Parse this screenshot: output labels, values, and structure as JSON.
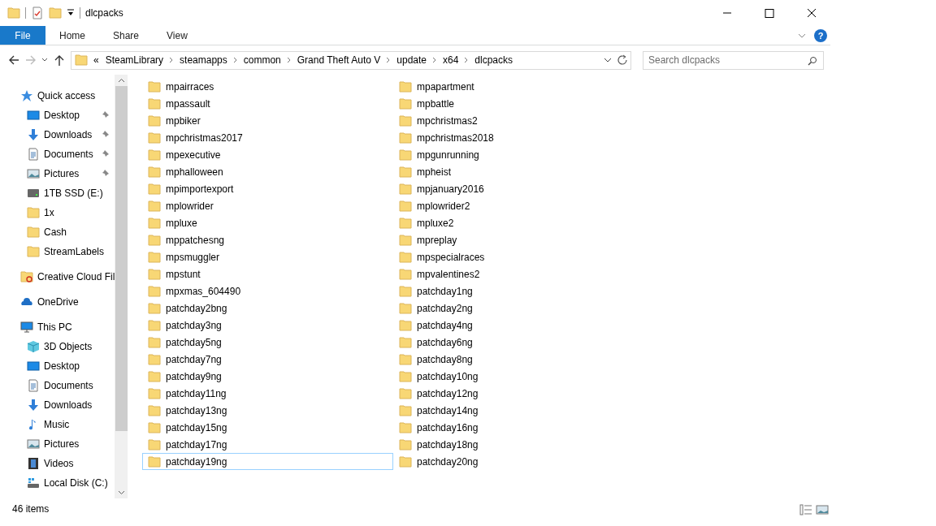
{
  "window": {
    "title": "dlcpacks"
  },
  "ribbon": {
    "tabs": [
      {
        "label": "File",
        "selected": true
      },
      {
        "label": "Home",
        "selected": false
      },
      {
        "label": "Share",
        "selected": false
      },
      {
        "label": "View",
        "selected": false
      }
    ],
    "help": "?"
  },
  "address_bar": {
    "overflow": "«",
    "segments": [
      "SteamLibrary",
      "steamapps",
      "common",
      "Grand Theft Auto V",
      "update",
      "x64",
      "dlcpacks"
    ]
  },
  "search": {
    "placeholder": "Search dlcpacks"
  },
  "sidebar": {
    "items": [
      {
        "label": "Quick access",
        "kind": "star",
        "children": [
          {
            "label": "Desktop",
            "kind": "desktop",
            "pinned": true
          },
          {
            "label": "Downloads",
            "kind": "downloads",
            "pinned": true
          },
          {
            "label": "Documents",
            "kind": "documents",
            "pinned": true
          },
          {
            "label": "Pictures",
            "kind": "pictures",
            "pinned": true
          },
          {
            "label": "1TB SSD (E:)",
            "kind": "drive",
            "pinned": false
          },
          {
            "label": "1x",
            "kind": "folder",
            "pinned": false
          },
          {
            "label": "Cash",
            "kind": "folder",
            "pinned": false
          },
          {
            "label": "StreamLabels",
            "kind": "folder",
            "pinned": false
          }
        ]
      },
      {
        "label": "Creative Cloud Fil",
        "kind": "cloudfolder"
      },
      {
        "label": "OneDrive",
        "kind": "onedrive"
      },
      {
        "label": "This PC",
        "kind": "pc",
        "children": [
          {
            "label": "3D Objects",
            "kind": "objects",
            "pinned": false
          },
          {
            "label": "Desktop",
            "kind": "desktop",
            "pinned": false
          },
          {
            "label": "Documents",
            "kind": "documents",
            "pinned": false
          },
          {
            "label": "Downloads",
            "kind": "downloads",
            "pinned": false
          },
          {
            "label": "Music",
            "kind": "music",
            "pinned": false
          },
          {
            "label": "Pictures",
            "kind": "pictures",
            "pinned": false
          },
          {
            "label": "Videos",
            "kind": "videos",
            "pinned": false
          },
          {
            "label": "Local Disk (C:)",
            "kind": "disk",
            "pinned": false
          }
        ]
      }
    ]
  },
  "files": [
    {
      "name": "mpairraces",
      "focused": false
    },
    {
      "name": "mpapartment",
      "focused": false
    },
    {
      "name": "mpassault",
      "focused": false
    },
    {
      "name": "mpbattle",
      "focused": false
    },
    {
      "name": "mpbiker",
      "focused": false
    },
    {
      "name": "mpchristmas2",
      "focused": false
    },
    {
      "name": "mpchristmas2017",
      "focused": false
    },
    {
      "name": "mpchristmas2018",
      "focused": false
    },
    {
      "name": "mpexecutive",
      "focused": false
    },
    {
      "name": "mpgunrunning",
      "focused": false
    },
    {
      "name": "mphalloween",
      "focused": false
    },
    {
      "name": "mpheist",
      "focused": false
    },
    {
      "name": "mpimportexport",
      "focused": false
    },
    {
      "name": "mpjanuary2016",
      "focused": false
    },
    {
      "name": "mplowrider",
      "focused": false
    },
    {
      "name": "mplowrider2",
      "focused": false
    },
    {
      "name": "mpluxe",
      "focused": false
    },
    {
      "name": "mpluxe2",
      "focused": false
    },
    {
      "name": "mppatchesng",
      "focused": false
    },
    {
      "name": "mpreplay",
      "focused": false
    },
    {
      "name": "mpsmuggler",
      "focused": false
    },
    {
      "name": "mpspecialraces",
      "focused": false
    },
    {
      "name": "mpstunt",
      "focused": false
    },
    {
      "name": "mpvalentines2",
      "focused": false
    },
    {
      "name": "mpxmas_604490",
      "focused": false
    },
    {
      "name": "patchday1ng",
      "focused": false
    },
    {
      "name": "patchday2bng",
      "focused": false
    },
    {
      "name": "patchday2ng",
      "focused": false
    },
    {
      "name": "patchday3ng",
      "focused": false
    },
    {
      "name": "patchday4ng",
      "focused": false
    },
    {
      "name": "patchday5ng",
      "focused": false
    },
    {
      "name": "patchday6ng",
      "focused": false
    },
    {
      "name": "patchday7ng",
      "focused": false
    },
    {
      "name": "patchday8ng",
      "focused": false
    },
    {
      "name": "patchday9ng",
      "focused": false
    },
    {
      "name": "patchday10ng",
      "focused": false
    },
    {
      "name": "patchday11ng",
      "focused": false
    },
    {
      "name": "patchday12ng",
      "focused": false
    },
    {
      "name": "patchday13ng",
      "focused": false
    },
    {
      "name": "patchday14ng",
      "focused": false
    },
    {
      "name": "patchday15ng",
      "focused": false
    },
    {
      "name": "patchday16ng",
      "focused": false
    },
    {
      "name": "patchday17ng",
      "focused": false
    },
    {
      "name": "patchday18ng",
      "focused": false
    },
    {
      "name": "patchday19ng",
      "focused": true
    },
    {
      "name": "patchday20ng",
      "focused": false
    }
  ],
  "status_bar": {
    "count": "46 items"
  }
}
